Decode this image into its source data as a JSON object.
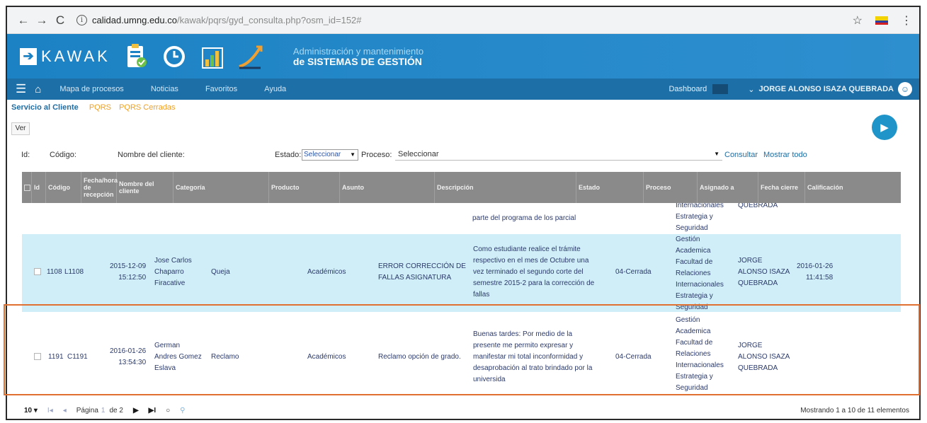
{
  "browser": {
    "back": "←",
    "forward": "→",
    "reload": "C",
    "url_host": "calidad.umng.edu.co",
    "url_path": "/kawak/pqrs/gyd_consulta.php?osm_id=152#",
    "star": "☆",
    "menu": "⋮"
  },
  "app": {
    "logo_text": "KAWAK",
    "subtitle1": "Administración y mantenimiento",
    "subtitle2": "de SISTEMAS DE GESTIÓN"
  },
  "nav": {
    "items": [
      "Mapa de procesos",
      "Noticias",
      "Favoritos",
      "Ayuda"
    ],
    "dashboard": "Dashboard",
    "user": "JORGE ALONSO ISAZA QUEBRADA"
  },
  "breadcrumbs": {
    "active": "Servicio al Cliente",
    "item1": "PQRS",
    "item2": "PQRS Cerradas"
  },
  "toolbar": {
    "ver": "Ver"
  },
  "filters": {
    "id": "Id:",
    "codigo": "Código:",
    "nombre": "Nombre del cliente:",
    "estado_label": "Estado:",
    "estado_value": "Seleccionar",
    "proceso_label": "Proceso:",
    "proceso_value": "Seleccionar",
    "consultar": "Consultar",
    "mostrar_todo": "Mostrar todo"
  },
  "table": {
    "headers": [
      "Id",
      "Código",
      "Fecha/hora de recepción",
      "Nombre del cliente",
      "Categoría",
      "Producto",
      "Asunto",
      "Descripción",
      "Estado",
      "Proceso",
      "Asignado a",
      "Fecha cierre",
      "Calificación"
    ],
    "cut_row": {
      "descripcion": "parte del programa de los parcial",
      "proceso": [
        "Internacionales",
        "Estrategia y",
        "Seguridad"
      ],
      "asignado": "QUEBRADA"
    },
    "rows": [
      {
        "id": "1108",
        "codigo": "L1108",
        "fecha": [
          "2015-12-09",
          "15:12:50"
        ],
        "nombre": [
          "Jose Carlos",
          "Chaparro",
          "Firacative"
        ],
        "categoria": "Queja",
        "producto": "Académicos",
        "asunto": [
          "ERROR CORRECCIÓN DE",
          "FALLAS ASIGNATURA"
        ],
        "descripcion": [
          "Como estudiante realice el trámite",
          "respectivo en el mes de Octubre una",
          "vez terminado el segundo corte del",
          "semestre 2015-2 para la corrección de",
          "fallas"
        ],
        "estado": "04-Cerrada",
        "proceso": [
          "Gestión",
          "Academica",
          "Facultad de",
          "Relaciones",
          "Internacionales",
          "Estrategia y",
          "Seguridad"
        ],
        "asignado": [
          "JORGE",
          "ALONSO ISAZA",
          "QUEBRADA"
        ],
        "cierre": [
          "2016-01-26",
          "11:41:58"
        ],
        "calificacion": ""
      },
      {
        "id": "1191",
        "codigo": "C1191",
        "fecha": [
          "2016-01-26",
          "13:54:30"
        ],
        "nombre": [
          "German",
          "Andres Gomez",
          "Eslava"
        ],
        "categoria": "Reclamo",
        "producto": "Académicos",
        "asunto": [
          "Reclamo opción de grado."
        ],
        "descripcion": [
          "Buenas tardes: Por medio de la",
          "presente me permito expresar y",
          "manifestar mi total inconformidad y",
          "desaprobación al trato brindado por la",
          "universida"
        ],
        "estado": "04-Cerrada",
        "proceso": [
          "Gestión",
          "Academica",
          "Facultad de",
          "Relaciones",
          "Internacionales",
          "Estrategia y",
          "Seguridad"
        ],
        "asignado": [
          "JORGE",
          "ALONSO ISAZA",
          "QUEBRADA"
        ],
        "cierre": [
          "",
          ""
        ],
        "calificacion": ""
      }
    ]
  },
  "pager": {
    "per_page": "10 ▾",
    "first": "I◂",
    "prev": "◂",
    "pagina": "Página",
    "page": "1",
    "de": "de 2",
    "next": "▶",
    "last": "▶I",
    "refresh": "○",
    "summary": "Mostrando 1 a 10 de 11 elementos"
  },
  "colors": {
    "header_blue": "#1c82c3",
    "navbar_blue": "#1d6fa8",
    "row_highlight": "#cfeef7",
    "annotation": "#e07030"
  }
}
